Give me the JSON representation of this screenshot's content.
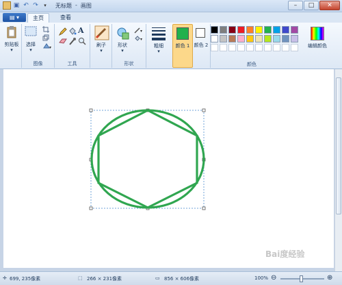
{
  "window": {
    "title": "无标题",
    "app": "画图"
  },
  "tabs": {
    "file": "",
    "home": "主页",
    "view": "查看"
  },
  "ribbon": {
    "clipboard": {
      "label": "剪贴板",
      "group": ""
    },
    "image": {
      "select": "选择",
      "group": "图像"
    },
    "tools": {
      "group": "工具"
    },
    "brushes": {
      "label": "刷子"
    },
    "shapes": {
      "label": "形状",
      "group": "形状"
    },
    "size": {
      "label": "粗细"
    },
    "color1": {
      "label": "颜色 1",
      "value": "#22b14c"
    },
    "color2": {
      "label": "颜色 2",
      "value": "#ffffff"
    },
    "edit_colors": {
      "label": "编辑颜色"
    },
    "colors_group": "颜色",
    "palette_row1": [
      "#000000",
      "#7f7f7f",
      "#880015",
      "#ed1c24",
      "#ff7f27",
      "#fff200",
      "#22b14c",
      "#00a2e8",
      "#3f48cc",
      "#a349a4"
    ],
    "palette_row2": [
      "#ffffff",
      "#c3c3c3",
      "#b97a57",
      "#ffaec9",
      "#ffc90e",
      "#efe4b0",
      "#b5e61d",
      "#99d9ea",
      "#7092be",
      "#c8bfe7"
    ]
  },
  "drawing": {
    "stroke_color": "#30a650"
  },
  "status": {
    "cursor": "699, 235像素",
    "selection": "266 × 231像素",
    "canvas_size": "856 × 606像素",
    "zoom": "100%"
  },
  "watermark": "Bai度经验"
}
